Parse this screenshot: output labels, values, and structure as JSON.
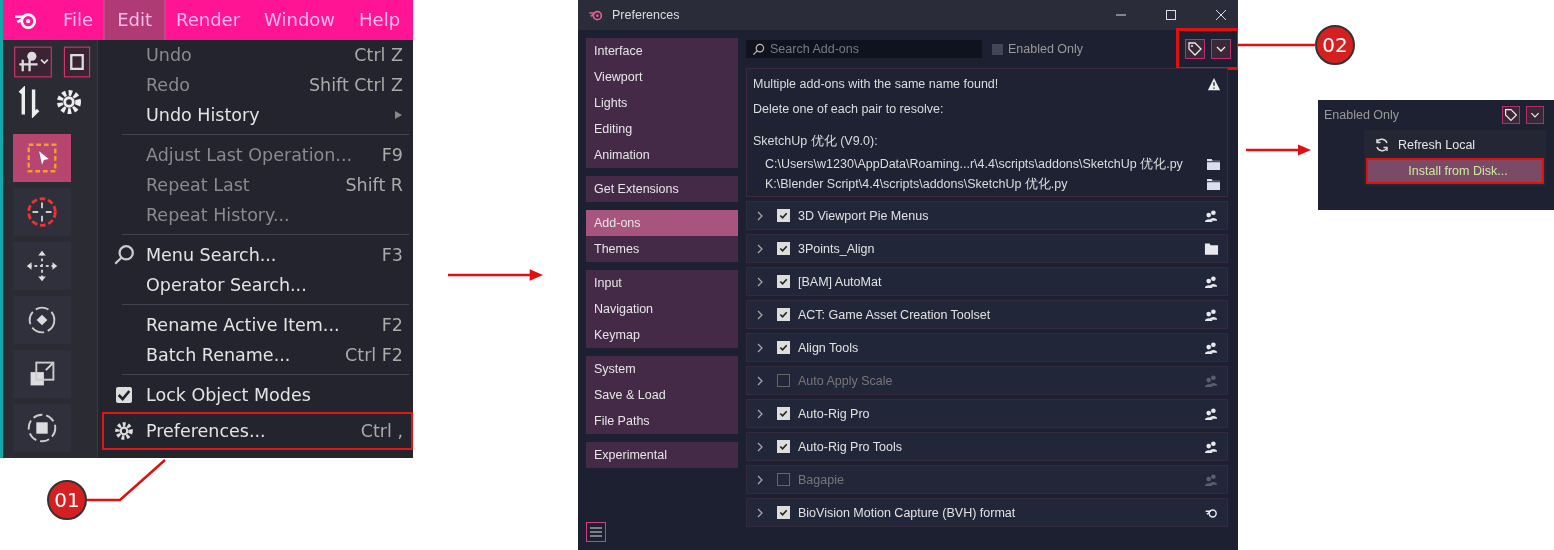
{
  "edit_panel": {
    "menu_bar": [
      {
        "label": "File",
        "selected": false
      },
      {
        "label": "Edit",
        "selected": true
      },
      {
        "label": "Render",
        "selected": false
      },
      {
        "label": "Window",
        "selected": false
      },
      {
        "label": "Help",
        "selected": false
      }
    ],
    "tools": [
      {
        "kind": "select",
        "selected": true
      },
      {
        "kind": "cursor",
        "selected": false
      },
      {
        "kind": "move",
        "selected": false
      },
      {
        "kind": "rotate",
        "selected": false
      },
      {
        "kind": "scale",
        "selected": false
      },
      {
        "kind": "transform",
        "selected": false
      }
    ],
    "menu": [
      {
        "kind": "item",
        "label": "Undo",
        "shortcut": "Ctrl Z",
        "disabled": true
      },
      {
        "kind": "item",
        "label": "Redo",
        "shortcut": "Shift Ctrl Z",
        "disabled": true
      },
      {
        "kind": "submenu",
        "label": "Undo History",
        "disabled": false
      },
      {
        "kind": "separator"
      },
      {
        "kind": "item",
        "label": "Adjust Last Operation...",
        "shortcut": "F9",
        "disabled": true
      },
      {
        "kind": "item",
        "label": "Repeat Last",
        "shortcut": "Shift R",
        "disabled": true
      },
      {
        "kind": "item",
        "label": "Repeat History...",
        "disabled": true
      },
      {
        "kind": "separator"
      },
      {
        "kind": "search",
        "label": "Menu Search...",
        "shortcut": "F3",
        "disabled": false
      },
      {
        "kind": "item",
        "label": "Operator Search...",
        "disabled": false
      },
      {
        "kind": "separator"
      },
      {
        "kind": "item",
        "label": "Rename Active Item...",
        "shortcut": "F2",
        "disabled": false
      },
      {
        "kind": "item",
        "label": "Batch Rename...",
        "shortcut": "Ctrl F2",
        "disabled": false
      },
      {
        "kind": "separator"
      },
      {
        "kind": "check",
        "label": "Lock Object Modes",
        "checked": true,
        "disabled": false
      },
      {
        "kind": "settings",
        "label": "Preferences...",
        "shortcut": "Ctrl ,",
        "disabled": false,
        "highlighted": true
      }
    ]
  },
  "callouts": [
    "01",
    "02"
  ],
  "preferences": {
    "window": {
      "title": "Preferences"
    },
    "sidebar": [
      {
        "items": [
          {
            "label": "Interface",
            "selected": false
          },
          {
            "label": "Viewport",
            "selected": false
          },
          {
            "label": "Lights",
            "selected": false
          },
          {
            "label": "Editing",
            "selected": false
          },
          {
            "label": "Animation",
            "selected": false
          }
        ]
      },
      {
        "items": [
          {
            "label": "Get Extensions",
            "selected": false
          }
        ]
      },
      {
        "items": [
          {
            "label": "Add-ons",
            "selected": true
          },
          {
            "label": "Themes",
            "selected": false
          }
        ]
      },
      {
        "items": [
          {
            "label": "Input",
            "selected": false
          },
          {
            "label": "Navigation",
            "selected": false
          },
          {
            "label": "Keymap",
            "selected": false
          }
        ]
      },
      {
        "items": [
          {
            "label": "System",
            "selected": false
          },
          {
            "label": "Save & Load",
            "selected": false
          },
          {
            "label": "File Paths",
            "selected": false
          }
        ]
      },
      {
        "items": [
          {
            "label": "Experimental",
            "selected": false
          }
        ]
      }
    ],
    "search": {
      "placeholder": "Search Add-ons"
    },
    "enabled_only": {
      "label": "Enabled Only",
      "checked": false
    },
    "warning": {
      "title": "Multiple add-ons with the same name found!",
      "message": "Delete one of each pair to resolve:",
      "addon": "SketchUp 优化 (V9.0):",
      "paths": [
        "C:\\Users\\w1230\\AppData\\Roaming...r\\4.4\\scripts\\addons\\SketchUp 优化.py",
        "K:\\Blender Script\\4.4\\scripts\\addons\\SketchUp 优化.py"
      ]
    },
    "addons": [
      {
        "name": "3D Viewport Pie Menus",
        "enabled": true,
        "kind": "community"
      },
      {
        "name": "3Points_Align",
        "enabled": true,
        "kind": "folder"
      },
      {
        "name": "[BAM] AutoMat",
        "enabled": true,
        "kind": "community"
      },
      {
        "name": "ACT: Game Asset Creation Toolset",
        "enabled": true,
        "kind": "community"
      },
      {
        "name": "Align Tools",
        "enabled": true,
        "kind": "community"
      },
      {
        "name": "Auto Apply Scale",
        "enabled": false,
        "kind": "community"
      },
      {
        "name": "Auto-Rig Pro",
        "enabled": true,
        "kind": "community"
      },
      {
        "name": "Auto-Rig Pro Tools",
        "enabled": true,
        "kind": "community"
      },
      {
        "name": "Bagapie",
        "enabled": false,
        "kind": "community"
      },
      {
        "name": "BioVision Motion Capture (BVH) format",
        "enabled": true,
        "kind": "blender"
      }
    ]
  },
  "inset": {
    "enabled_only": {
      "label": "Enabled Only"
    },
    "menu": [
      {
        "kind": "refresh",
        "label": "Refresh Local",
        "highlighted": false
      },
      {
        "kind": "item",
        "label": "Install from Disk...",
        "highlighted": true
      }
    ]
  }
}
